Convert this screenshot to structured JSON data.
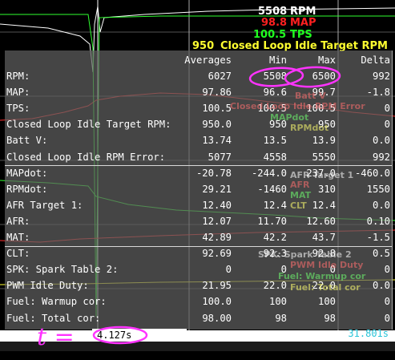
{
  "header": {
    "rpm": {
      "value": "5508",
      "label": "RPM",
      "color": "#ffffff"
    },
    "map": {
      "value": "98.8",
      "label": "MAP",
      "color": "#ff2020"
    },
    "tps": {
      "value": "100.5",
      "label": "TPS",
      "color": "#20ff20"
    },
    "target": {
      "value": "950",
      "label": "Closed Loop Idle Target RPM",
      "color": "#ffff30"
    }
  },
  "ghost_labels": [
    "Batt V",
    "Closed Loop Idle RPM Error",
    "MAPdot",
    "RPMdot",
    "AFR Target 1",
    "AFR",
    "MAT",
    "CLT",
    "SPK: Spark Table 2",
    "PWM Idle Duty",
    "Fuel: Warmup cor",
    "Fuel: Total cor"
  ],
  "stats": {
    "columns": [
      "Averages",
      "Min",
      "Max",
      "Delta"
    ],
    "rows": [
      {
        "label": "RPM:",
        "avg": "6027",
        "min": "5508",
        "max": "6500",
        "delta": "992"
      },
      {
        "label": "MAP:",
        "avg": "97.86",
        "min": "96.6",
        "max": "99.7",
        "delta": "-1.8"
      },
      {
        "label": "TPS:",
        "avg": "100.5",
        "min": "100.5",
        "max": "100.5",
        "delta": "0"
      },
      {
        "label": "Closed Loop Idle Target RPM:",
        "avg": "950.0",
        "min": "950",
        "max": "950",
        "delta": "0"
      },
      {
        "label": "Batt V:",
        "avg": "13.74",
        "min": "13.5",
        "max": "13.9",
        "delta": "0.0"
      },
      {
        "label": "Closed Loop Idle RPM Error:",
        "avg": "5077",
        "min": "4558",
        "max": "5550",
        "delta": "992"
      },
      {
        "label": "MAPdot:",
        "avg": "-20.78",
        "min": "-244.0",
        "max": "237.0",
        "delta": "-460.0"
      },
      {
        "label": "RPMdot:",
        "avg": "29.21",
        "min": "-1460",
        "max": "310",
        "delta": "1550"
      },
      {
        "label": "AFR Target 1:",
        "avg": "12.40",
        "min": "12.4",
        "max": "12.4",
        "delta": "0.0"
      },
      {
        "label": "AFR:",
        "avg": "12.07",
        "min": "11.70",
        "max": "12.60",
        "delta": "0.10"
      },
      {
        "label": "MAT:",
        "avg": "42.89",
        "min": "42.2",
        "max": "43.7",
        "delta": "-1.5"
      },
      {
        "label": "CLT:",
        "avg": "92.69",
        "min": "92.3",
        "max": "92.8",
        "delta": "0.5"
      },
      {
        "label": "SPK: Spark Table 2:",
        "avg": "0",
        "min": "0",
        "max": "0",
        "delta": "0"
      },
      {
        "label": "PWM Idle Duty:",
        "avg": "21.95",
        "min": "22.0",
        "max": "22.0",
        "delta": "0.0"
      },
      {
        "label": "Fuel: Warmup cor:",
        "avg": "100.0",
        "min": "100",
        "max": "100",
        "delta": "0"
      },
      {
        "label": "Fuel: Total cor:",
        "avg": "98.00",
        "min": "98",
        "max": "98",
        "delta": "0"
      }
    ]
  },
  "time": {
    "cursor": "4.127s",
    "end": "31.801s"
  },
  "annotation": {
    "text": "t =",
    "color": "#ff33ff"
  }
}
